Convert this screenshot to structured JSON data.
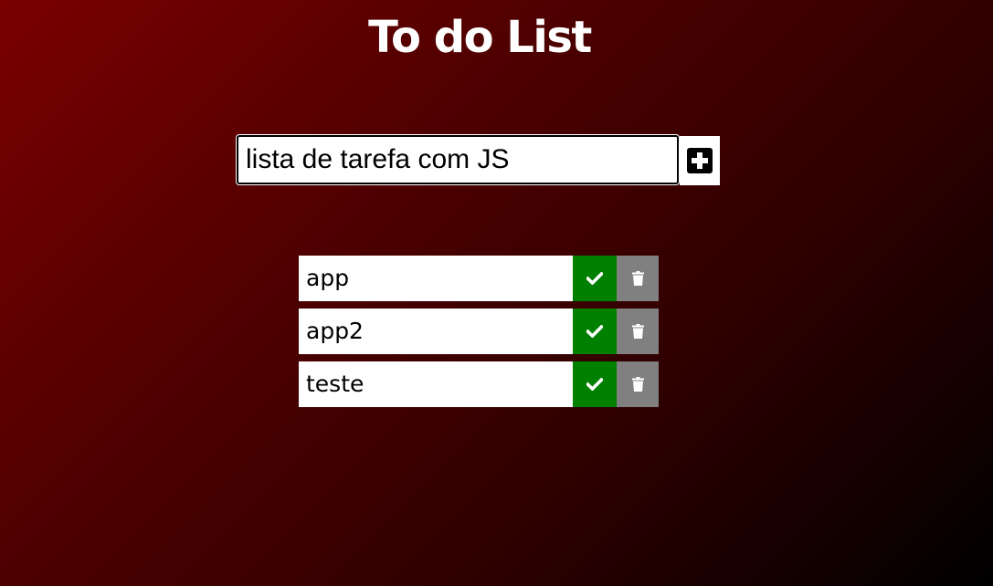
{
  "header": {
    "title": "To do List"
  },
  "form": {
    "input_value": "lista de tarefa com JS",
    "add_icon": "plus-square-icon"
  },
  "todos": [
    {
      "text": "app"
    },
    {
      "text": "app2"
    },
    {
      "text": "teste"
    }
  ],
  "icons": {
    "complete": "check-icon",
    "delete": "trash-icon"
  },
  "colors": {
    "background_start": "#7a0000",
    "background_end": "#000000",
    "complete_button": "#008000",
    "delete_button": "#808080"
  }
}
